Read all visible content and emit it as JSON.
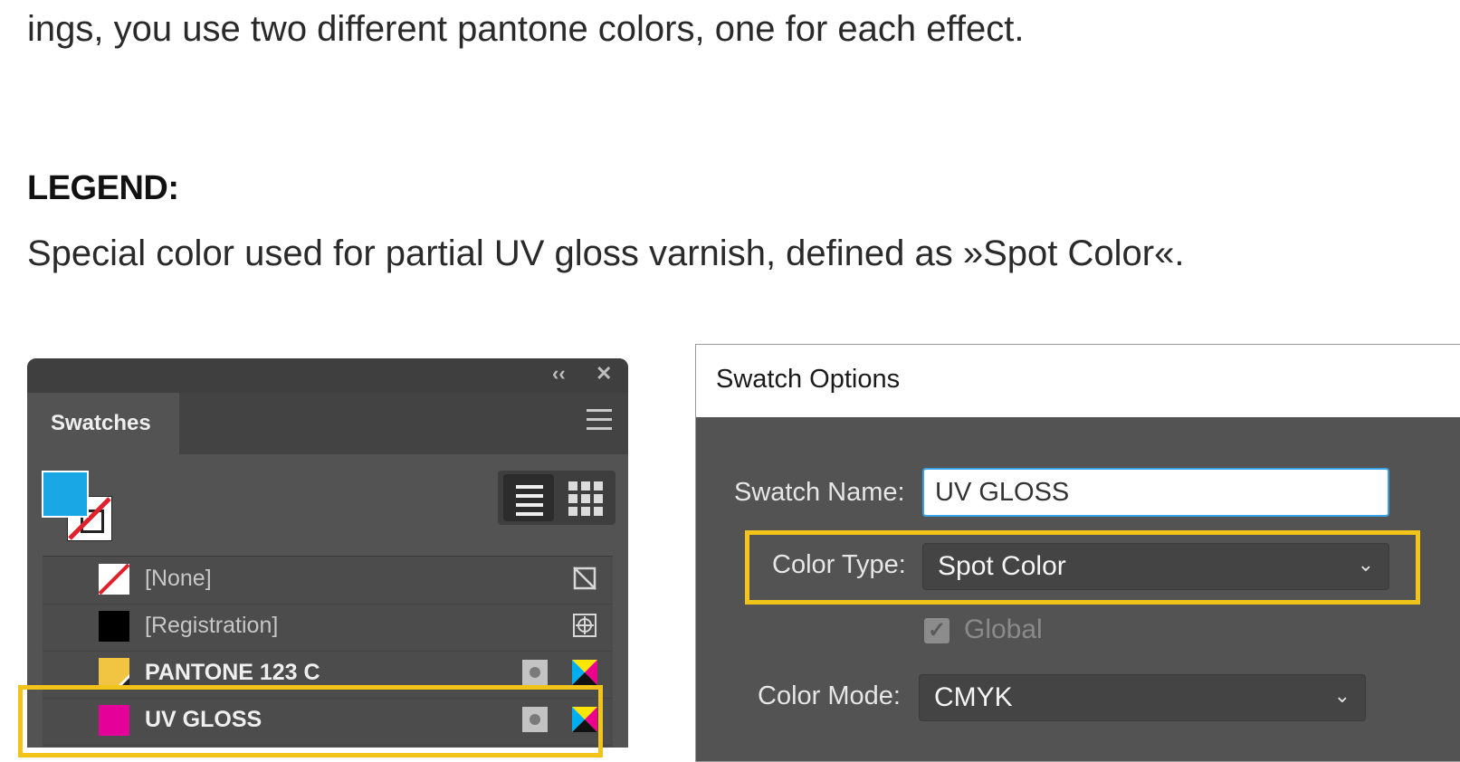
{
  "article": {
    "intro": "ings, you use two different pantone colors, one for each effect.",
    "legend_heading": "LEGEND:",
    "legend_text": "Special color used for partial UV gloss varnish, defined as »Spot Color«."
  },
  "swatches_panel": {
    "tab_label": "Swatches",
    "fill_color": "#1aa7e6",
    "rows": [
      {
        "label": "[None]",
        "chip": "none",
        "icons": [
          "no-edit-icon"
        ]
      },
      {
        "label": "[Registration]",
        "chip": "#000000",
        "icons": [
          "registration-icon"
        ]
      },
      {
        "label": "PANTONE 123 C",
        "chip": "#f1c542",
        "icons": [
          "spot-color-icon",
          "cmyk-icon"
        ]
      },
      {
        "label": "UV GLOSS",
        "chip": "#e5009a",
        "icons": [
          "spot-color-icon",
          "cmyk-icon"
        ]
      }
    ],
    "highlight_color": "#f2c318"
  },
  "swatch_options": {
    "title": "Swatch Options",
    "swatch_name_label": "Swatch Name:",
    "swatch_name_value": "UV GLOSS",
    "color_type_label": "Color Type:",
    "color_type_value": "Spot Color",
    "global_label": "Global",
    "color_mode_label": "Color Mode:",
    "color_mode_value": "CMYK"
  }
}
